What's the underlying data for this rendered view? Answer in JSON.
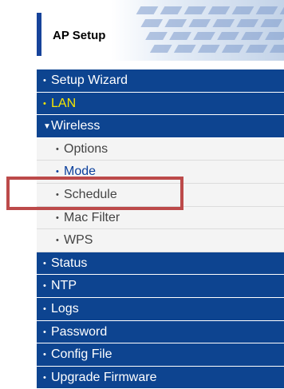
{
  "header": {
    "title": "AP Setup"
  },
  "menu": {
    "setup_wizard": "Setup Wizard",
    "lan": "LAN",
    "wireless": "Wireless",
    "wireless_sub": {
      "options": "Options",
      "mode": "Mode",
      "schedule": "Schedule",
      "mac_filter": "Mac Filter",
      "wps": "WPS"
    },
    "status": "Status",
    "ntp": "NTP",
    "logs": "Logs",
    "password": "Password",
    "config_file": "Config File",
    "upgrade_firmware": "Upgrade Firmware"
  },
  "colors": {
    "nav_background": "#0d4490",
    "submenu_background": "#f4f4f4",
    "highlight_text": "#f5e500",
    "annotation_border": "#bc4a4a"
  }
}
